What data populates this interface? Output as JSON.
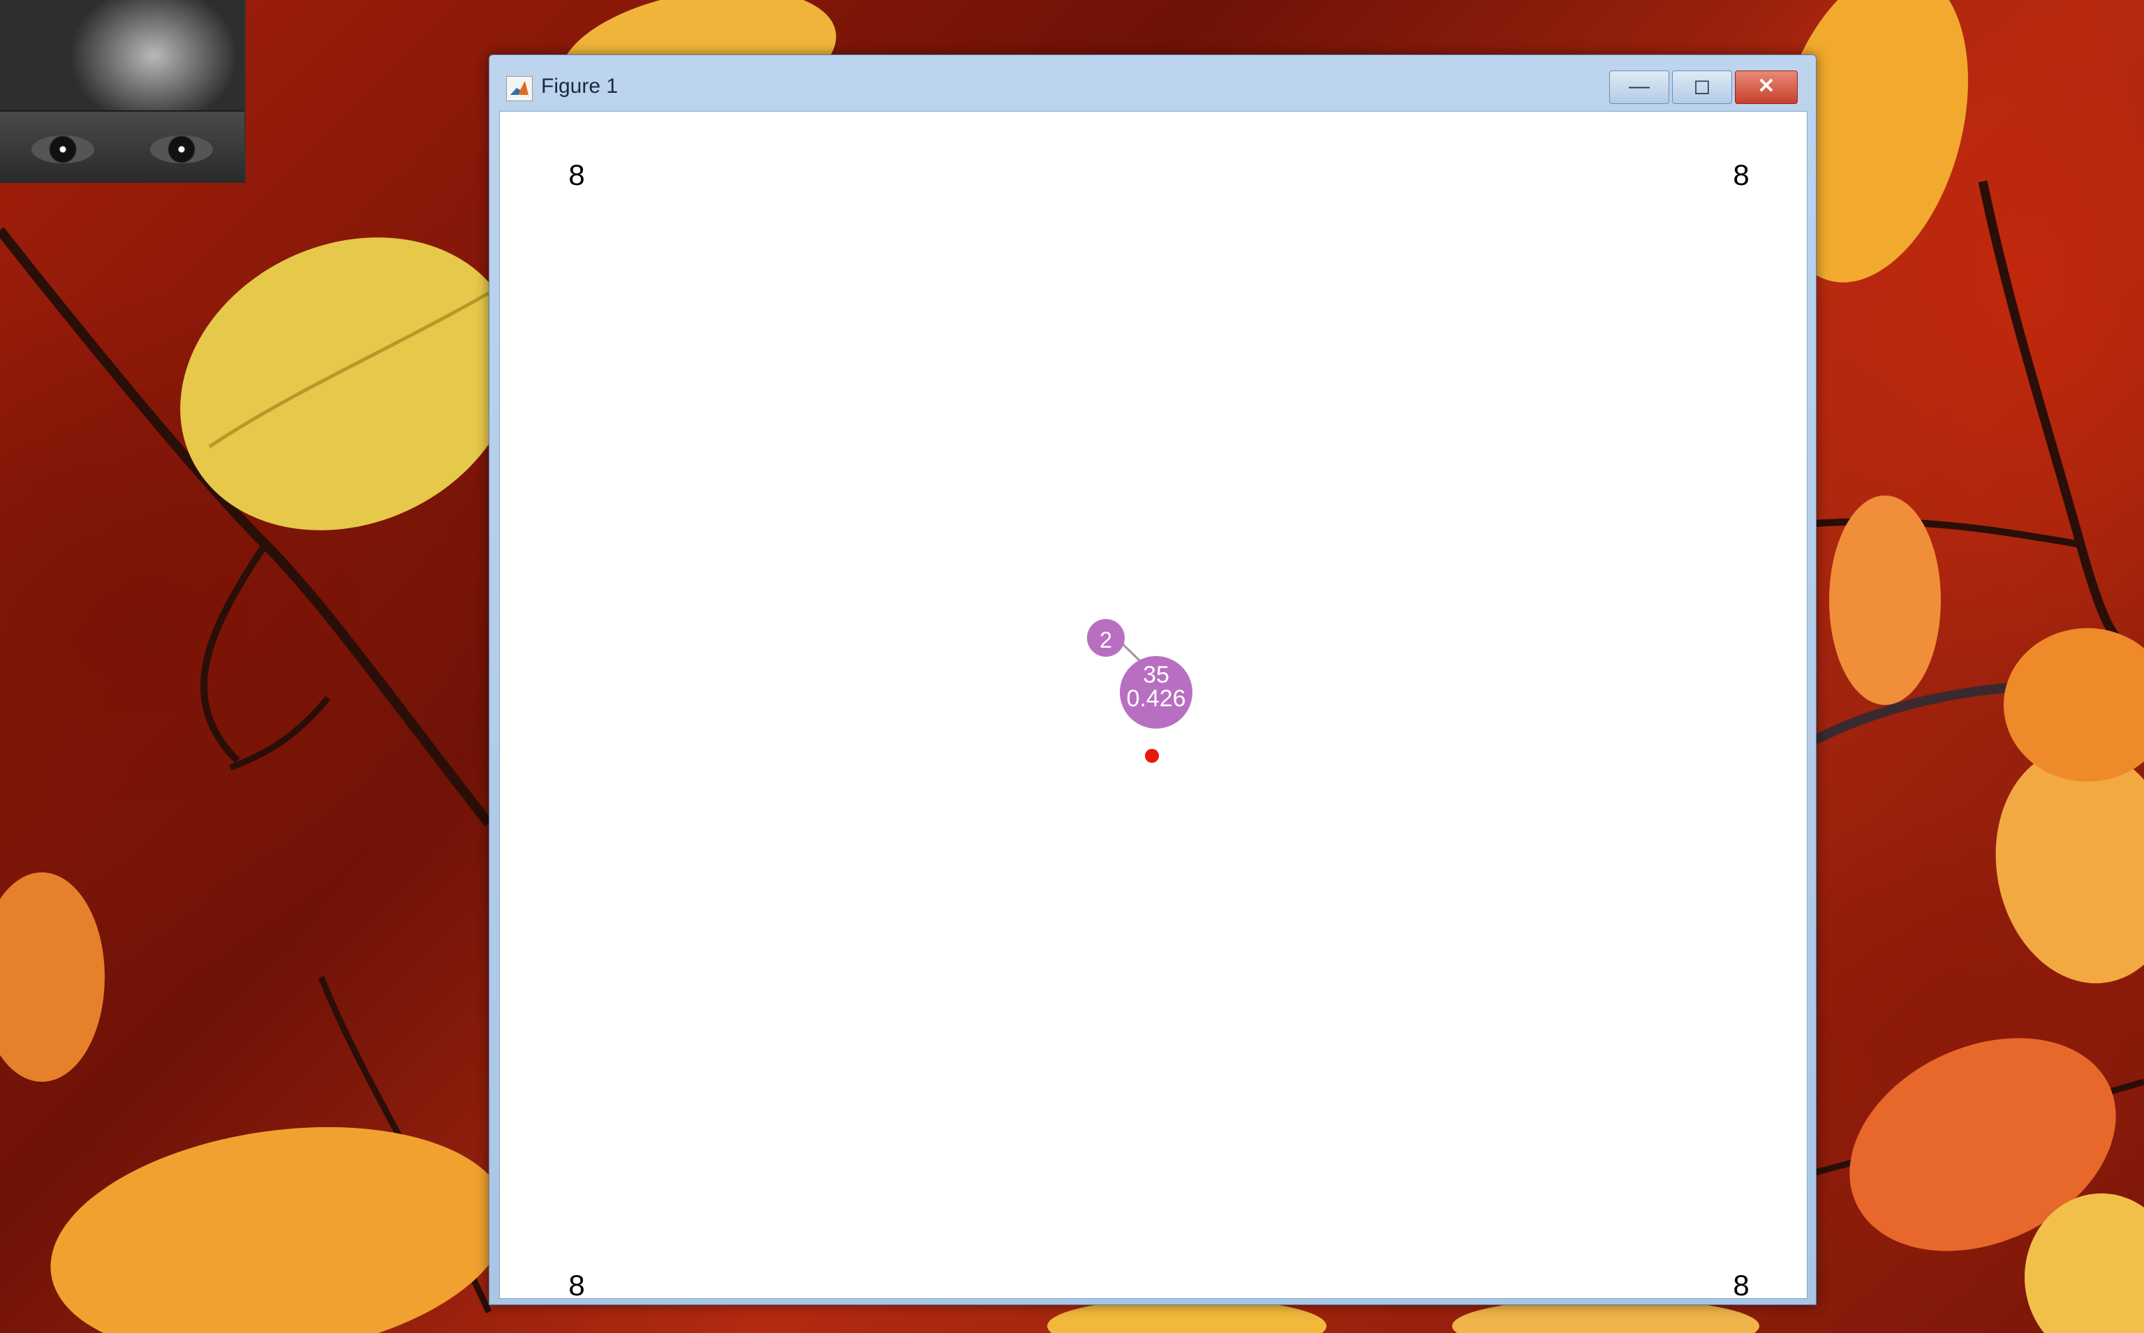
{
  "window": {
    "title": "Figure 1",
    "minimize_symbol": "—",
    "maximize_symbol": "◻",
    "close_symbol": "✕"
  },
  "icons": {
    "window_icon": "matlab-logo-icon",
    "webcam": "webcam-feed"
  },
  "plot": {
    "corner_labels": {
      "top_left": "8",
      "top_right": "8",
      "bottom_left": "8",
      "bottom_right": "8"
    },
    "nodes": [
      {
        "id": "small",
        "label_top": "",
        "label_bottom": "2",
        "color": "#b86fc2"
      },
      {
        "id": "large",
        "label_top": "35",
        "label_bottom": "0.426",
        "color": "#b86fc2"
      }
    ],
    "marker_color": "#e8190a"
  },
  "colors": {
    "window_frame": "#a9c6e6",
    "close_button": "#c8402c",
    "plot_background": "#ffffff"
  }
}
